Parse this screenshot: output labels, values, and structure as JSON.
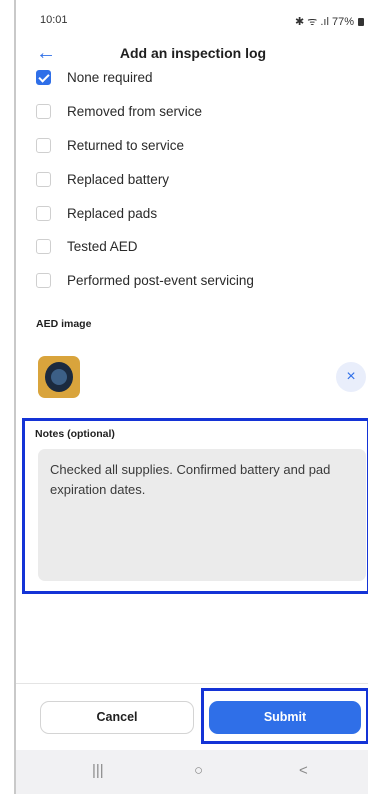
{
  "status_bar": {
    "time": "10:01",
    "indicators": "✱ ᯤ .ıl 77%"
  },
  "header": {
    "title": "Add an inspection log",
    "back_icon": "←"
  },
  "checklist": [
    {
      "label": "None required",
      "checked": true
    },
    {
      "label": "Removed from service",
      "checked": false
    },
    {
      "label": "Returned to service",
      "checked": false
    },
    {
      "label": "Replaced battery",
      "checked": false
    },
    {
      "label": "Replaced pads",
      "checked": false
    },
    {
      "label": "Tested AED",
      "checked": false
    },
    {
      "label": "Performed post-event servicing",
      "checked": false
    }
  ],
  "aed_image": {
    "label": "AED image",
    "remove_icon": "×"
  },
  "notes": {
    "label": "Notes (optional)",
    "value": "Checked all supplies. Confirmed battery and pad expiration dates."
  },
  "footer": {
    "cancel_label": "Cancel",
    "submit_label": "Submit"
  },
  "nav": {
    "recents": "|||",
    "home": "○",
    "back": "<"
  },
  "colors": {
    "accent": "#2f6fe8",
    "highlight": "#1433d6"
  }
}
